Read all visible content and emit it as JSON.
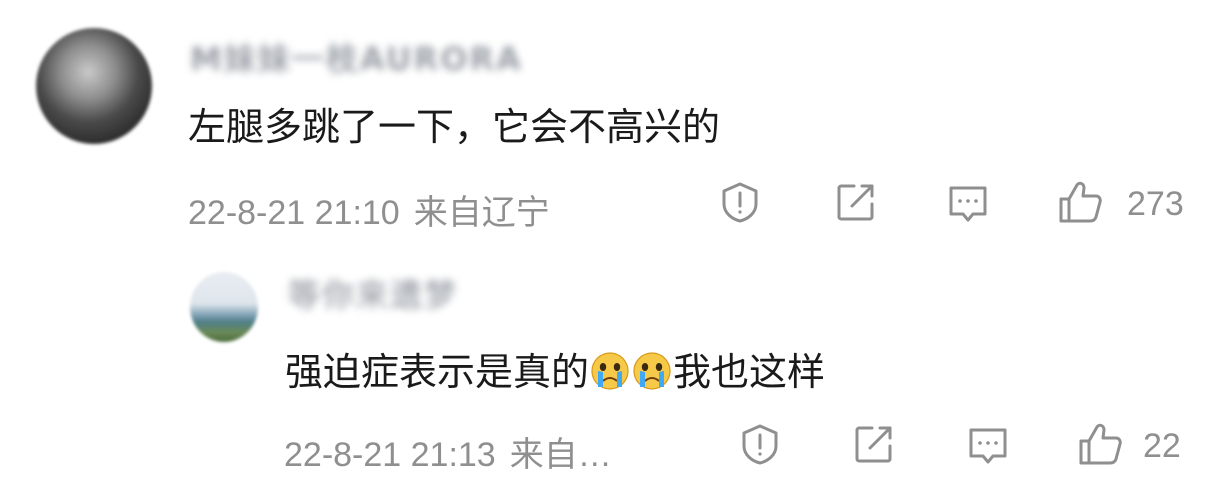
{
  "comments": [
    {
      "username": "M妹妹一枝AURORA",
      "text": "左腿多跳了一下，它会不高兴的",
      "time": "22-8-21 21:10",
      "location": "来自辽宁",
      "likes": "273"
    },
    {
      "username": "等你来遗梦",
      "text_before": "强迫症表示是真的",
      "emojis": [
        "crying-face-emoji",
        "crying-face-emoji"
      ],
      "text_after": "我也这样",
      "time": "22-8-21 21:13",
      "location": "来自…",
      "likes": "22"
    }
  ],
  "colors": {
    "text_primary": "#1a1a1a",
    "text_secondary": "#8f8f8f",
    "icon": "#8f8f8f",
    "emoji_face": "#f7c948",
    "emoji_tear": "#3fa9f5"
  }
}
